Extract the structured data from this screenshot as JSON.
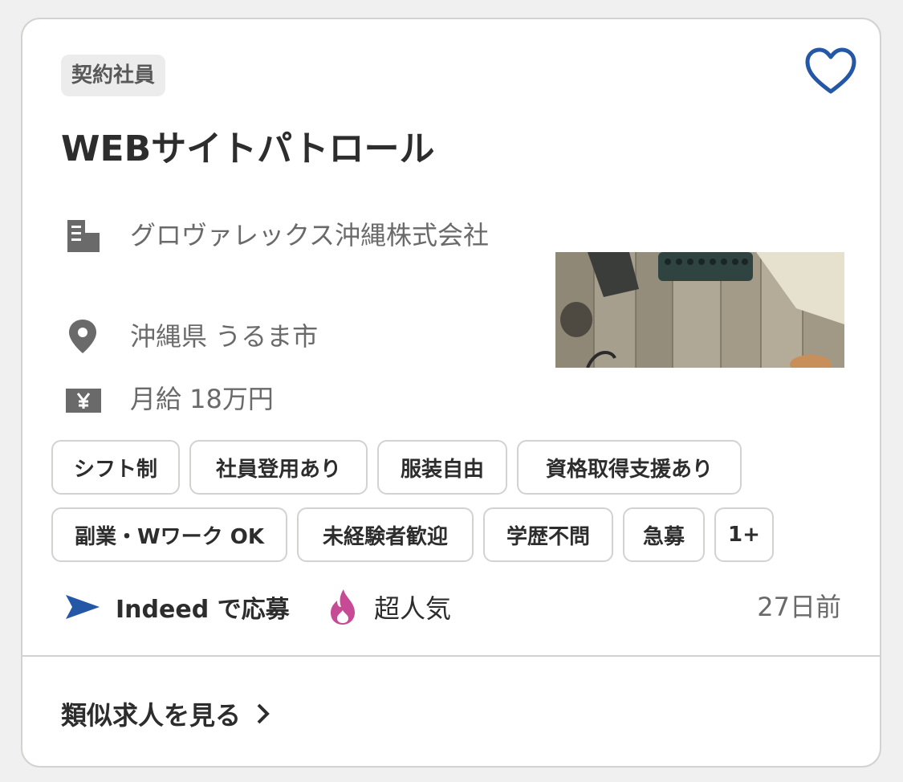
{
  "card": {
    "job_type": "契約社員",
    "title": "WEBサイトパトロール",
    "company": "グロヴァレックス沖縄株式会社",
    "location": "沖縄県 うるま市",
    "salary": "月給 18万円",
    "tags": [
      "シフト制",
      "社員登用あり",
      "服装自由",
      "資格取得支援あり",
      "副業・Wワーク OK",
      "未経験者歓迎",
      "学歴不問",
      "急募",
      "1+"
    ],
    "apply_label": "Indeed で応募",
    "popular_label": "超人気",
    "posted": "27日前",
    "similar_label": "類似求人を見る"
  },
  "icons": {
    "favorite": "heart-outline-icon",
    "company": "building-icon",
    "location": "map-pin-icon",
    "salary": "yen-icon",
    "apply": "send-arrow-icon",
    "popular": "flame-icon",
    "similar": "chevron-right-icon"
  },
  "colors": {
    "accent_blue": "#2557a7",
    "flame": "#c74a95",
    "text": "#2d2d2d",
    "muted": "#6a6a6a",
    "border": "#d4d2d0"
  }
}
